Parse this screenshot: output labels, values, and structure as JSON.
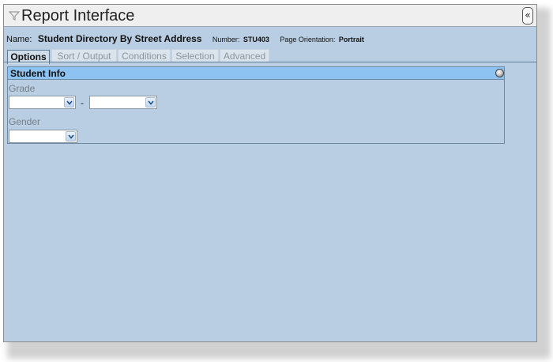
{
  "window": {
    "title": "Report Interface",
    "collapse_glyph": "«",
    "filter_icon": "filter-icon"
  },
  "report": {
    "name_label": "Name:",
    "name_value": "Student Directory By Street Address",
    "number_label": "Number:",
    "number_value": "STU403",
    "orientation_label": "Page Orientation:",
    "orientation_value": "Portrait"
  },
  "tabs": [
    {
      "label": "Options",
      "active": true
    },
    {
      "label": "Sort / Output",
      "active": false
    },
    {
      "label": "Conditions",
      "active": false
    },
    {
      "label": "Selection",
      "active": false
    },
    {
      "label": "Advanced",
      "active": false
    }
  ],
  "panel": {
    "title": "Student Info",
    "fields": {
      "grade": {
        "label": "Grade",
        "from_value": "",
        "separator": "-",
        "to_value": ""
      },
      "gender": {
        "label": "Gender",
        "value": ""
      }
    }
  },
  "colors": {
    "background": "#b9cee2",
    "panel_header": "#8cc3f3",
    "title_bar": "#efefef"
  }
}
